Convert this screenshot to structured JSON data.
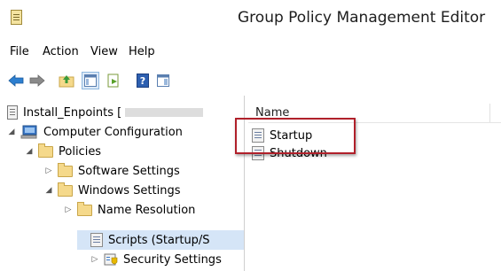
{
  "window": {
    "title": "Group Policy Management Editor"
  },
  "menu": {
    "items": [
      "File",
      "Action",
      "View",
      "Help"
    ]
  },
  "toolbar": {
    "icons": [
      "back-arrow-icon",
      "forward-arrow-icon",
      "up-folder-icon",
      "show-tree-icon",
      "export-list-icon",
      "help-icon",
      "properties-pane-icon"
    ]
  },
  "tree": {
    "items": [
      {
        "label": "Install_Enpoints [",
        "icon": "gpo-icon"
      },
      {
        "label": "Computer Configuration",
        "icon": "computer-icon",
        "expander": "◢"
      },
      {
        "label": "Policies",
        "icon": "folder-icon",
        "expander": "◢"
      },
      {
        "label": "Software Settings",
        "icon": "folder-icon",
        "expander": "▷"
      },
      {
        "label": "Windows Settings",
        "icon": "folder-icon",
        "expander": "◢"
      },
      {
        "label": "Name Resolution",
        "icon": "folder-icon",
        "expander": "▷"
      },
      {
        "label": "Scripts (Startup/S",
        "icon": "script-icon",
        "selected": true
      },
      {
        "label": "Security Settings",
        "icon": "security-icon",
        "expander": "▷"
      }
    ]
  },
  "list": {
    "column": "Name",
    "items": [
      {
        "label": "Startup",
        "icon": "script-icon"
      },
      {
        "label": "Shutdown",
        "icon": "script-icon"
      }
    ]
  },
  "colors": {
    "highlight": "#b0202a",
    "selection": "#d5e5f7"
  }
}
